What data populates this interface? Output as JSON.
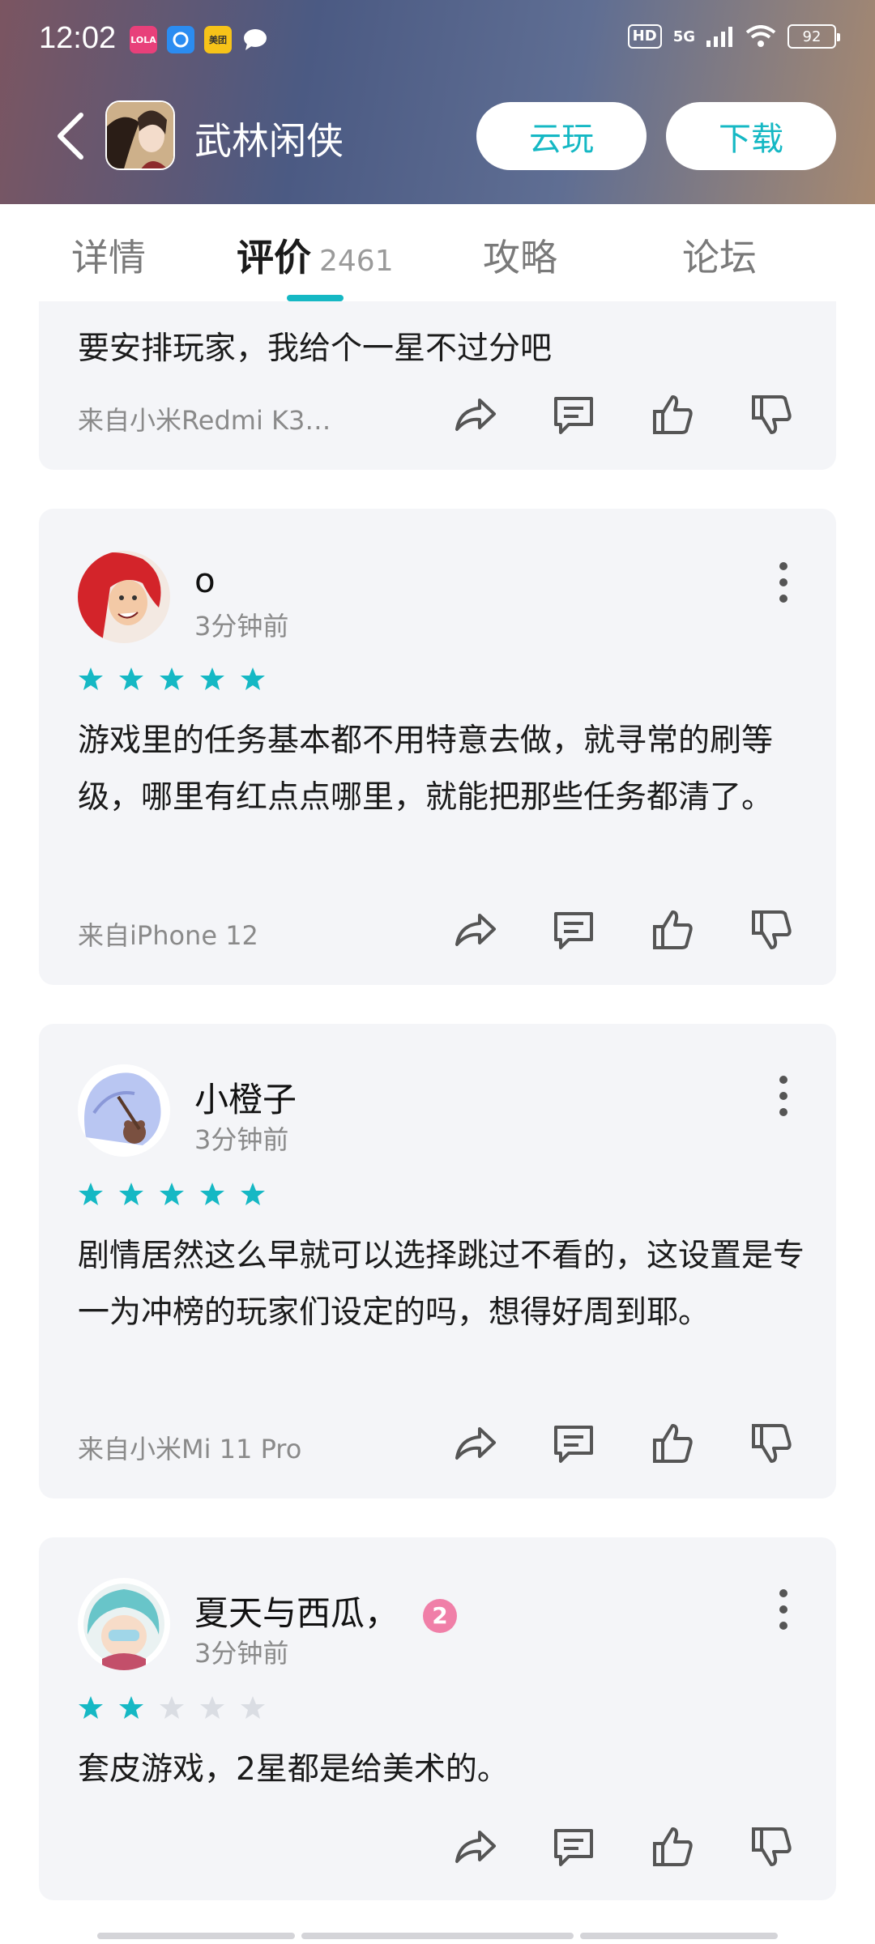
{
  "status_bar": {
    "time": "12:02",
    "app_icons": [
      {
        "name": "lofter-app-icon",
        "label": "LOLA",
        "color": "#e8407a"
      },
      {
        "name": "browser-app-icon",
        "label": "",
        "color": "#2b8cf1"
      },
      {
        "name": "meituan-app-icon",
        "label": "美团",
        "color": "#f7c319"
      },
      {
        "name": "message-app-icon",
        "label": "",
        "color": "#ffffff"
      }
    ],
    "hd": "HD",
    "network": "5G",
    "battery": "92"
  },
  "header": {
    "game_title": "武林闲侠",
    "cloud_play_label": "云玩",
    "download_label": "下载",
    "accent_color": "#15b8c4"
  },
  "tabs": [
    {
      "label": "详情"
    },
    {
      "label": "评价",
      "count": "2461"
    },
    {
      "label": "攻略"
    },
    {
      "label": "论坛"
    }
  ],
  "reviews": [
    {
      "text": "要安排玩家，我给个一星不过分吧",
      "device": "来自小米Redmi K3…"
    },
    {
      "username": "o",
      "time": "3分钟前",
      "rating": 5,
      "text": "游戏里的任务基本都不用特意去做，就寻常的刷等级，哪里有红点点哪里，就能把那些任务都清了。",
      "device": "来自iPhone 12"
    },
    {
      "username": "小橙子",
      "time": "3分钟前",
      "rating": 5,
      "text": "剧情居然这么早就可以选择跳过不看的，这设置是专一为冲榜的玩家们设定的吗，想得好周到耶。",
      "device": "来自小米Mi 11 Pro"
    },
    {
      "username": "夏天与西瓜，",
      "level_badge": "2",
      "time": "3分钟前",
      "rating": 2,
      "text": "套皮游戏，2星都是给美术的。",
      "device": ""
    }
  ]
}
